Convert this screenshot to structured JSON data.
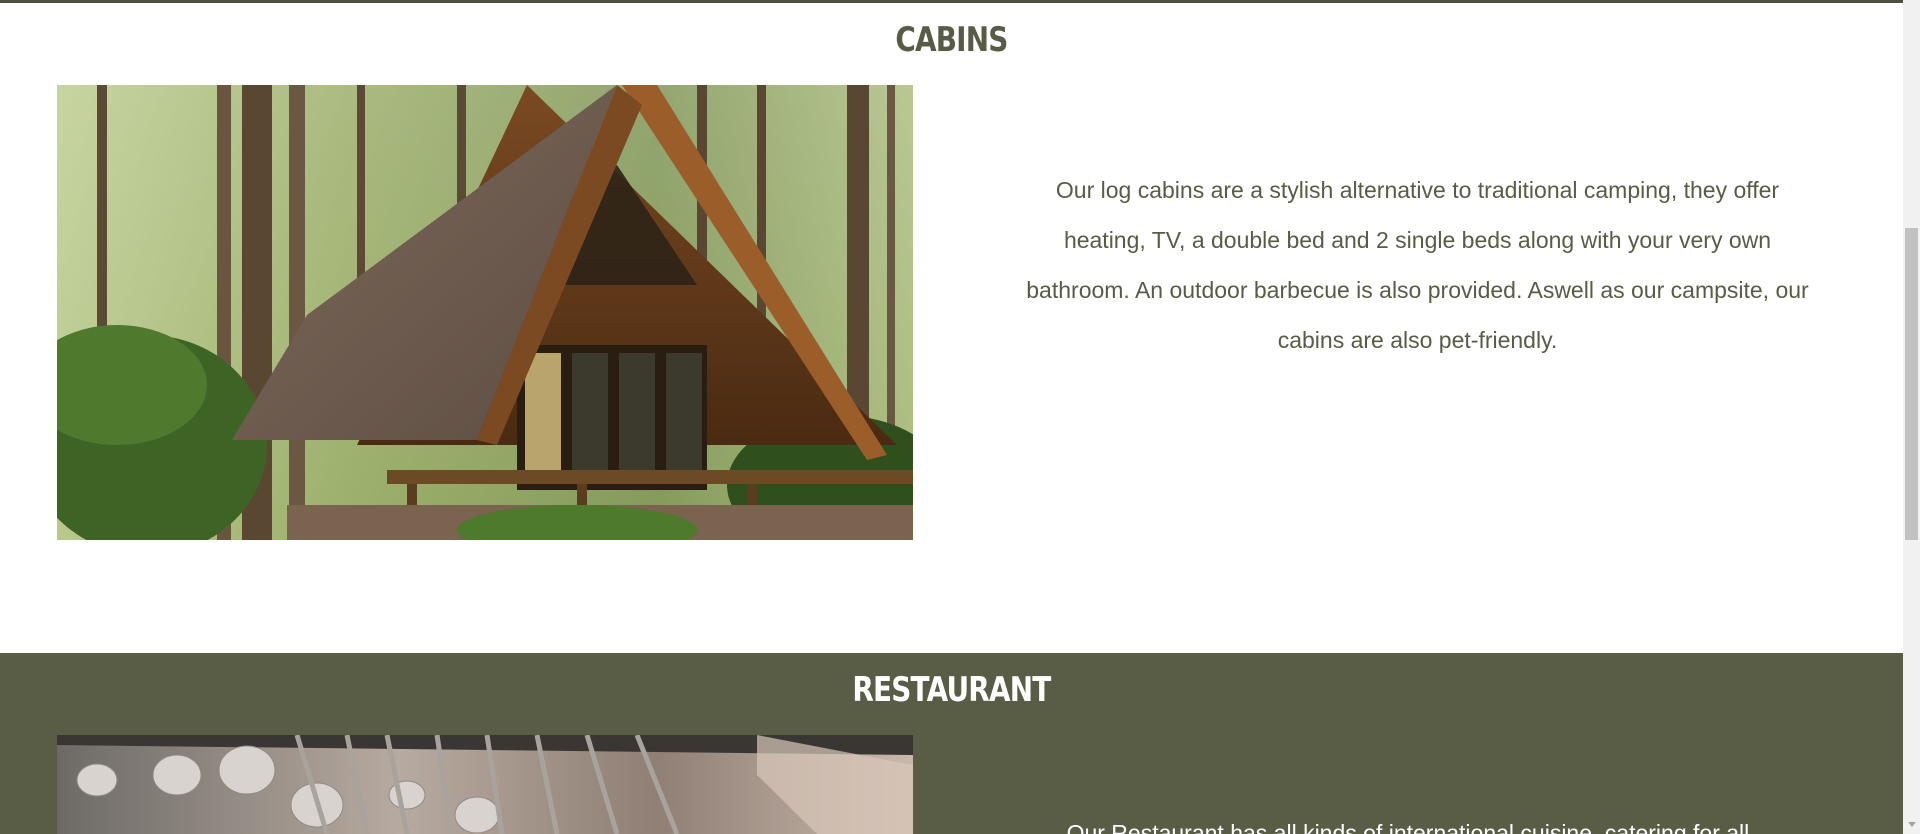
{
  "cabins": {
    "title": "CABINS",
    "description": "Our log cabins are a stylish alternative to traditional camping, they offer heating, TV, a double bed and 2 single beds along with your very own bathroom. An outdoor barbecue is also provided. Aswell as our campsite, our cabins are also pet-friendly.",
    "image_alt": "A-frame log cabin in pine forest"
  },
  "restaurant": {
    "title": "RESTAURANT",
    "description": "Our Restaurant has all kinds of international cuisine, catering for all...",
    "image_alt": "Restaurant kitchen with hanging utensils"
  },
  "colors": {
    "accent": "#585c46",
    "band": "#5a5d46",
    "text_light": "#ffffff"
  }
}
